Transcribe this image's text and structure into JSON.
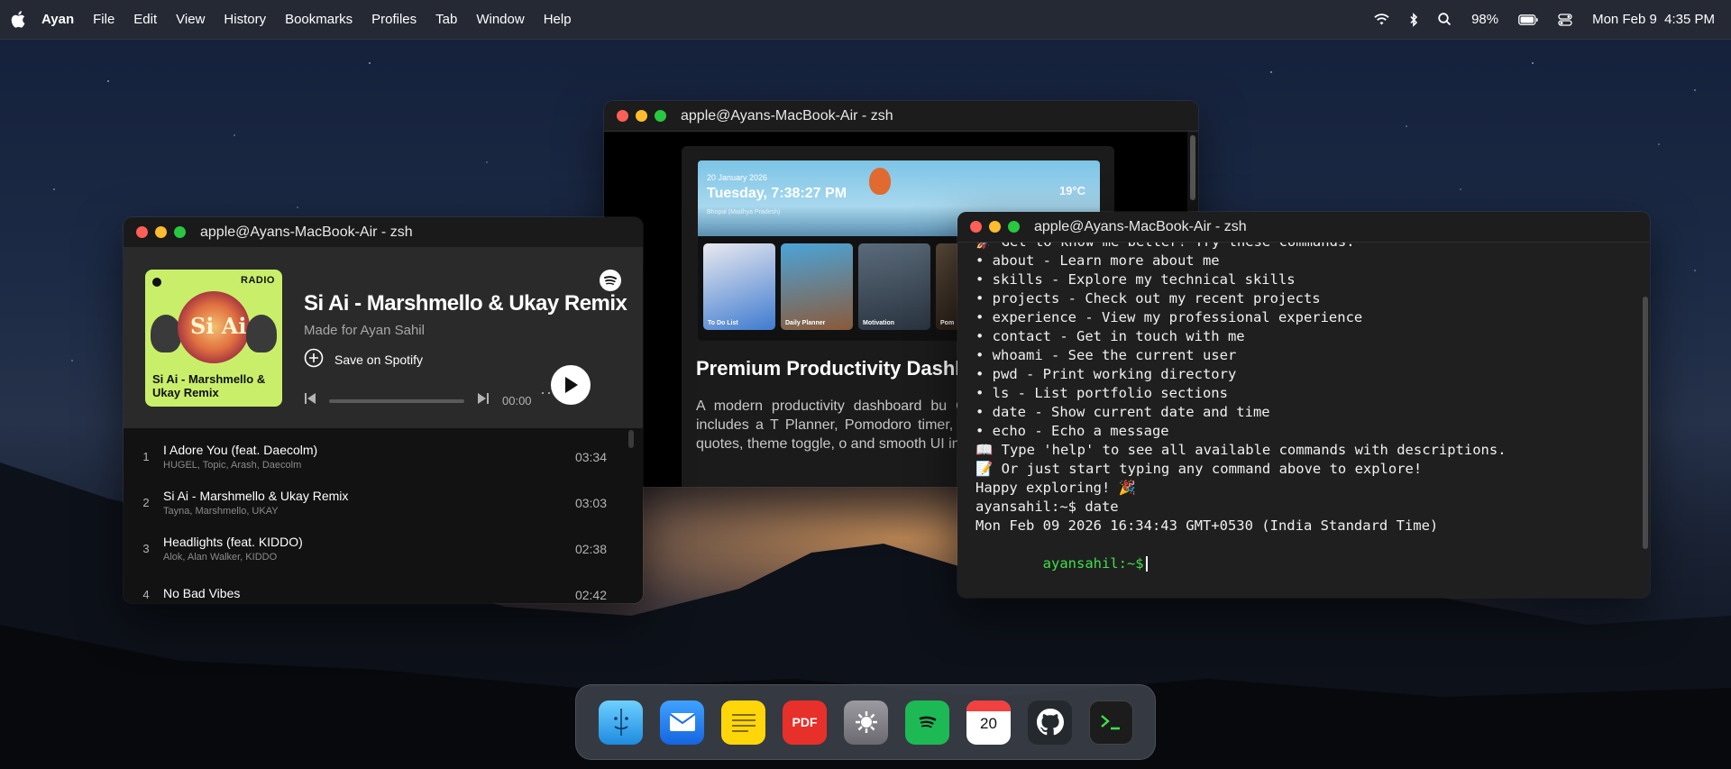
{
  "menubar": {
    "app_name": "Ayan",
    "items": [
      "File",
      "Edit",
      "View",
      "History",
      "Bookmarks",
      "Profiles",
      "Tab",
      "Window",
      "Help"
    ],
    "battery": "98%",
    "datetime": "Mon Feb 9  4:35 PM"
  },
  "spotify_window": {
    "title": "apple@Ayans-MacBook-Air - zsh",
    "cover_badge": "RADIO",
    "cover_title": "Si Ai - Marshmello & Ukay Remix",
    "cover_art_text": "Si Ai",
    "track_title": "Si Ai - Marshmello & Ukay Remix",
    "subtitle": "Made for Ayan Sahil",
    "save_label": "Save on Spotify",
    "time": "00:00",
    "more": "···",
    "tracks": [
      {
        "num": "1",
        "name": "I Adore You (feat. Daecolm)",
        "artists": "HUGEL, Topic, Arash, Daecolm",
        "duration": "03:34"
      },
      {
        "num": "2",
        "name": "Si Ai - Marshmello & Ukay Remix",
        "artists": "Tayna, Marshmello, UKAY",
        "duration": "03:03"
      },
      {
        "num": "3",
        "name": "Headlights (feat. KIDDO)",
        "artists": "Alok, Alan Walker, KIDDO",
        "duration": "02:38"
      },
      {
        "num": "4",
        "name": "No Bad Vibes",
        "artists": "",
        "duration": "02:42"
      }
    ]
  },
  "mid_window": {
    "title": "apple@Ayans-MacBook-Air - zsh",
    "preview": {
      "date_small": "20 January 2026",
      "datetime": "Tuesday, 7:38:27 PM",
      "location": "Bhopal (Madhya Pradesh)",
      "temperature": "19°C",
      "thumbs": [
        "To Do List",
        "Daily Planner",
        "Motivation",
        "Pom"
      ]
    },
    "project_title": "Premium Productivity Dashl",
    "project_desc": "A modern productivity dashboard bu CSS, and JavaScript. It includes a T Planner, Pomodoro timer, Daily Goals motivational quotes, theme toggle, o and smooth UI interactions."
  },
  "terminal": {
    "title": "apple@Ayans-MacBook-Air - zsh",
    "lines": [
      "🚀 Get to know me better! Try these commands:",
      "• about - Learn more about me",
      "• skills - Explore my technical skills",
      "• projects - Check out my recent projects",
      "• experience - View my professional experience",
      "• contact - Get in touch with me",
      "• whoami - See the current user",
      "• pwd - Print working directory",
      "• ls - List portfolio sections",
      "• date - Show current date and time",
      "• echo - Echo a message",
      "📖 Type 'help' to see all available commands with descriptions.",
      "📝 Or just start typing any command above to explore!",
      "Happy exploring! 🎉",
      "ayansahil:~$ date",
      "Mon Feb 09 2026 16:34:43 GMT+0530 (India Standard Time)"
    ],
    "prompt": "ayansahil:~$"
  },
  "dock": {
    "pdf_label": "PDF",
    "calendar_day": "20",
    "icons": [
      "finder-icon",
      "mail-icon",
      "notes-icon",
      "pdf-icon",
      "settings-icon",
      "spotify-icon",
      "calendar-icon",
      "github-icon",
      "terminal-icon"
    ]
  }
}
